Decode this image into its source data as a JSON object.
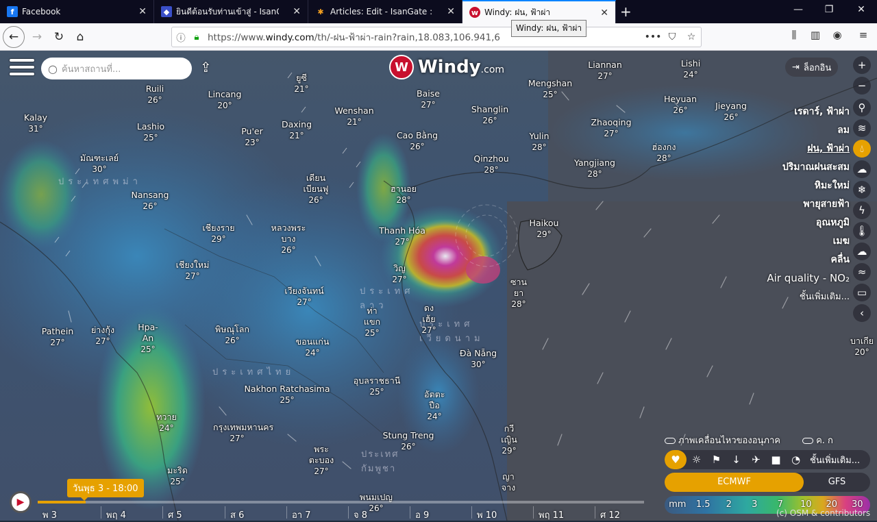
{
  "browser": {
    "tabs": [
      {
        "title": "Facebook",
        "favicon": "F",
        "favicon_color": "#1877f2"
      },
      {
        "title": "ยินดีต้อนรับท่านเข้าสู่ - IsanGate :",
        "favicon": "◆",
        "favicon_color": "#3a4fc8"
      },
      {
        "title": "Articles: Edit - IsanGate : ประตูสู่",
        "favicon": "✱",
        "favicon_color": "#f4a020"
      },
      {
        "title": "Windy: ฝน, ฟ้าผ่า",
        "favicon": "W",
        "favicon_color": "#c8102e"
      }
    ],
    "tooltip": "Windy: ฝน, ฟ้าผ่า",
    "url_prefix": "https://www.",
    "url_domain": "windy.com",
    "url_path": "/th/-ฝน-ฟ้าผ่า-rain?rain,18.083,106.941,6"
  },
  "map": {
    "search_placeholder": "ค้นหาสถานที่...",
    "logo_text": "Windy",
    "logo_suffix": ".com",
    "login_label": "ล็อกอิน",
    "places": [
      {
        "name": "Kalay",
        "temp": "31°"
      },
      {
        "name": "Ruili",
        "temp": "26°"
      },
      {
        "name": "Lincang",
        "temp": "20°"
      },
      {
        "name": "ยูซี",
        "temp": "21°"
      },
      {
        "name": "Lashio",
        "temp": "25°"
      },
      {
        "name": "Pu'er",
        "temp": "23°"
      },
      {
        "name": "Daxing",
        "temp": "21°"
      },
      {
        "name": "Wenshan",
        "temp": "21°"
      },
      {
        "name": "Baise",
        "temp": "27°"
      },
      {
        "name": "Cao Bằng",
        "temp": "26°"
      },
      {
        "name": "Shanglin",
        "temp": "26°"
      },
      {
        "name": "Yulin",
        "temp": "28°"
      },
      {
        "name": "Zhaoqing",
        "temp": "27°"
      },
      {
        "name": "Heyuan",
        "temp": "26°"
      },
      {
        "name": "Jieyang",
        "temp": "26°"
      },
      {
        "name": "Mengshan",
        "temp": "25°"
      },
      {
        "name": "Liannan",
        "temp": "27°"
      },
      {
        "name": "Lishi",
        "temp": "24°"
      },
      {
        "name": "ฮ่องกง",
        "temp": "28°"
      },
      {
        "name": "Yangjiang",
        "temp": "28°"
      },
      {
        "name": "Qinzhou",
        "temp": "28°"
      },
      {
        "name": "ฮานอย",
        "temp": "28°"
      },
      {
        "name": "Thanh Hóa",
        "temp": "27°"
      },
      {
        "name": "Haikou",
        "temp": "29°"
      },
      {
        "name": "มัณฑะเลย์",
        "temp": "30°"
      },
      {
        "name": "Nansang",
        "temp": "26°"
      },
      {
        "name": "เดียนเบียนฟู",
        "temp": "26°"
      },
      {
        "name": "เชียงราย",
        "temp": "29°"
      },
      {
        "name": "หลวงพระบาง",
        "temp": "26°"
      },
      {
        "name": "เชียงใหม่",
        "temp": "27°"
      },
      {
        "name": "เวียงจันทน์",
        "temp": "27°"
      },
      {
        "name": "วิญ",
        "temp": "27°"
      },
      {
        "name": "ซานยา",
        "temp": "28°"
      },
      {
        "name": "ท่าแขก",
        "temp": "25°"
      },
      {
        "name": "ดงเฮ้ย",
        "temp": "27°"
      },
      {
        "name": "Pathein",
        "temp": "27°"
      },
      {
        "name": "ย่างกุ้ง",
        "temp": "27°"
      },
      {
        "name": "Hpa-An",
        "temp": "25°"
      },
      {
        "name": "พิษณุโลก",
        "temp": "26°"
      },
      {
        "name": "ขอนแก่น",
        "temp": "24°"
      },
      {
        "name": "Đà Nẵng",
        "temp": "30°"
      },
      {
        "name": "อุบลราชธานี",
        "temp": "25°"
      },
      {
        "name": "Nakhon Ratchasima",
        "temp": "25°"
      },
      {
        "name": "ทวาย",
        "temp": "24°"
      },
      {
        "name": "กรุงเทพมหานคร",
        "temp": "27°"
      },
      {
        "name": "อัตตะปือ",
        "temp": "24°"
      },
      {
        "name": "Stung Treng",
        "temp": "26°"
      },
      {
        "name": "กวีเญิน",
        "temp": "29°"
      },
      {
        "name": "พระตะบอง",
        "temp": "27°"
      },
      {
        "name": "มะริด",
        "temp": "25°"
      },
      {
        "name": "ญาจาง",
        "temp": ""
      },
      {
        "name": "พนมเปญ",
        "temp": "26°"
      },
      {
        "name": "บาเกีย",
        "temp": "20°"
      }
    ],
    "countries": [
      "ประเทศพม่า",
      "ประเทศลาว",
      "ประเทศเวียดนาม",
      "ประเทศไทย",
      "ประเทศกัมพูชา"
    ],
    "layers": [
      "เรดาร์, ฟ้าผ่า",
      "ลม",
      "ฝน, ฟ้าผ่า",
      "ปริมาณฝนสะสม",
      "หิมะใหม่",
      "พายุสายฟ้า",
      "อุณหภูมิ",
      "เมฆ",
      "คลื่น",
      "Air quality - NO₂",
      "ชั้นเพิ่มเติม..."
    ],
    "active_layer": "ฝน, ฟ้าผ่า",
    "toggle_particles": "ภาพเคลื่อนไหวของอนุภาค",
    "toggle_other": "ค. ก",
    "icon_row_more": "ชั้นเพิ่มเติม...",
    "models": [
      "ECMWF",
      "GFS"
    ],
    "active_model": "ECMWF",
    "legend_unit": "mm",
    "legend_values": [
      "1.5",
      "2",
      "3",
      "7",
      "10",
      "20",
      "30"
    ],
    "copyright": "(c) OSM & contributors",
    "time_bubble": "วันพุธ 3 - 18:00",
    "days": [
      "พ 3",
      "พฤ 4",
      "ศ 5",
      "ส 6",
      "อา 7",
      "จ 8",
      "อ 9",
      "พ 10",
      "พฤ 11",
      "ศ 12"
    ],
    "accent_color": "#e6a100",
    "brand_color": "#c8102e"
  }
}
